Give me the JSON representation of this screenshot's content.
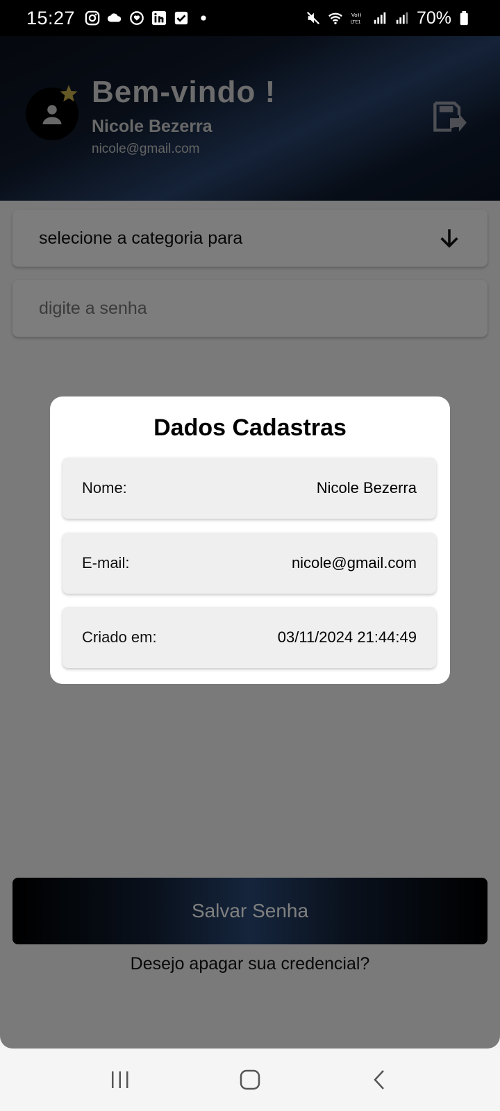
{
  "status_bar": {
    "time": "15:27",
    "battery": "70%"
  },
  "header": {
    "welcome": "Bem-vindo !",
    "name": "Nicole Bezerra",
    "email": "nicole@gmail.com"
  },
  "form": {
    "category_select": "selecione a categoria para",
    "password_placeholder": "digite a senha",
    "save_button": "Salvar Senha",
    "delete_link": "Desejo apagar sua credencial?"
  },
  "modal": {
    "title": "Dados Cadastras",
    "rows": [
      {
        "label": "Nome:",
        "value": "Nicole Bezerra"
      },
      {
        "label": "E-mail:",
        "value": "nicole@gmail.com"
      },
      {
        "label": "Criado em:",
        "value": "03/11/2024 21:44:49"
      }
    ]
  },
  "colors": {
    "header_gradient_dark": "#0a0f1a",
    "header_gradient_light": "#2a4570",
    "star": "#e8c547"
  }
}
